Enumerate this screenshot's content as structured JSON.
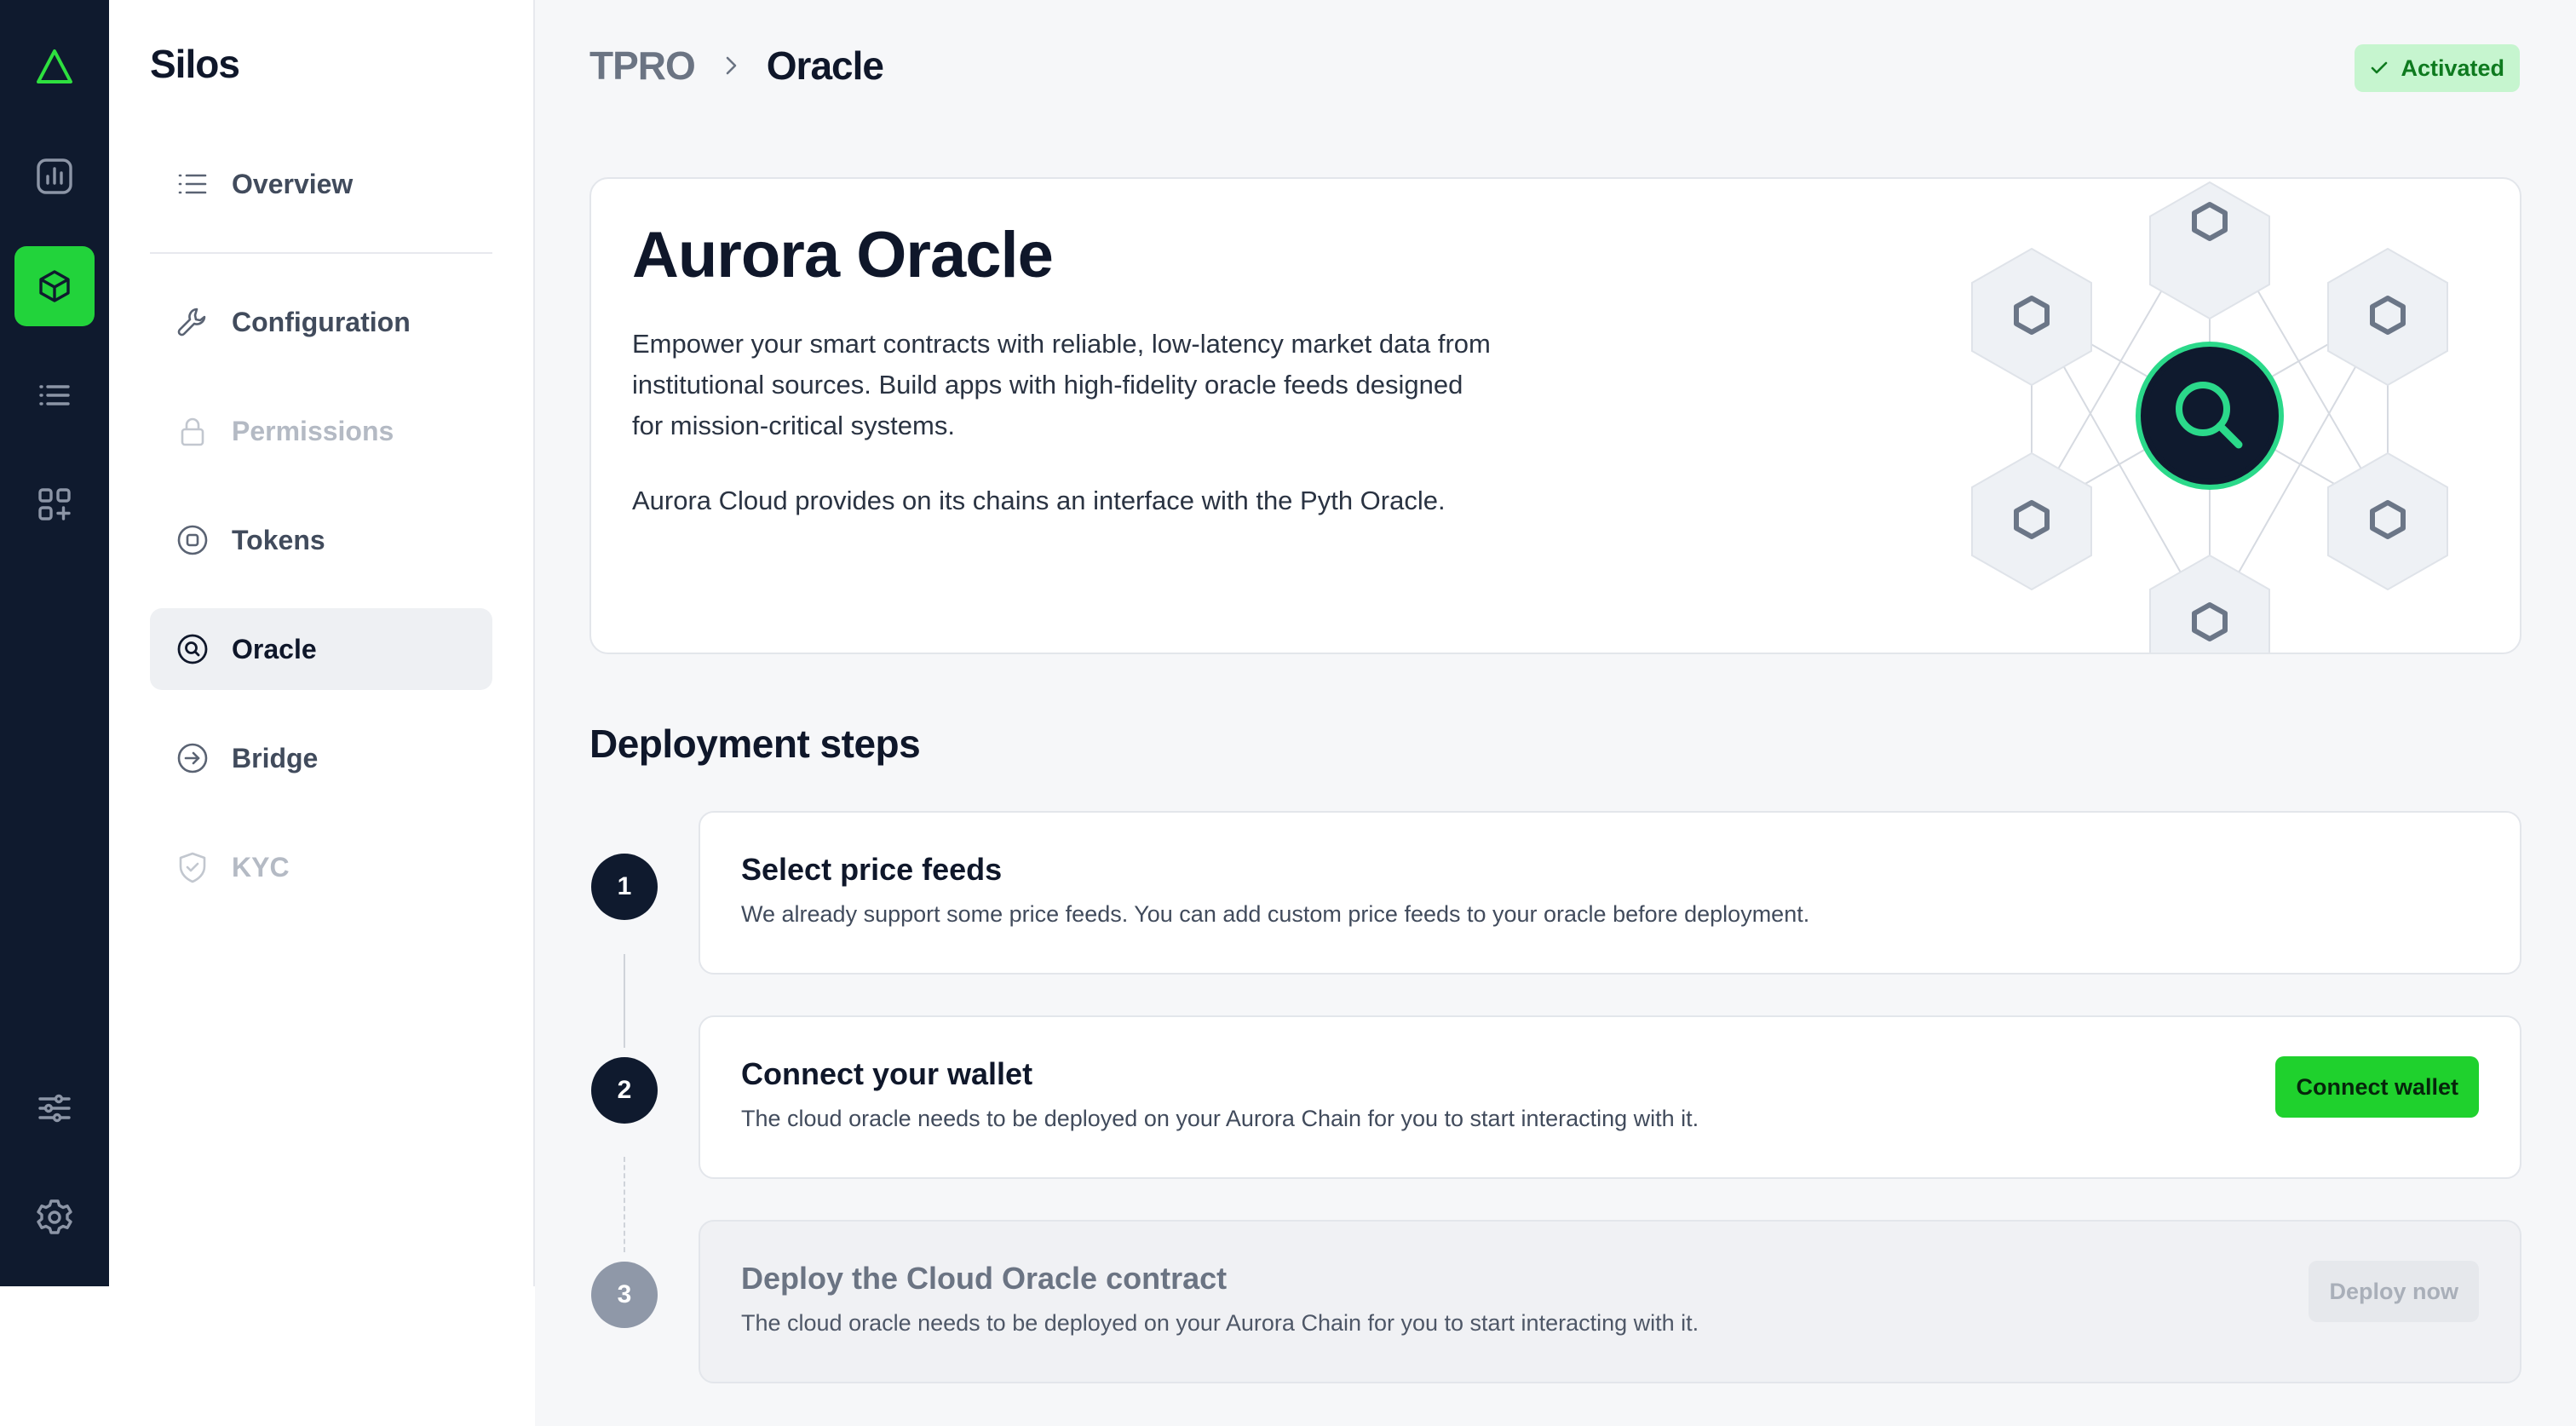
{
  "sidebar": {
    "title": "Silos",
    "items": [
      {
        "label": "Overview"
      },
      {
        "label": "Configuration"
      },
      {
        "label": "Permissions"
      },
      {
        "label": "Tokens"
      },
      {
        "label": "Oracle"
      },
      {
        "label": "Bridge"
      },
      {
        "label": "KYC"
      }
    ]
  },
  "header": {
    "breadcrumb_parent": "TPRO",
    "breadcrumb_current": "Oracle",
    "status_label": "Activated"
  },
  "hero": {
    "title": "Aurora Oracle",
    "paragraph1": "Empower your smart contracts with reliable, low-latency market data from institutional sources. Build apps with high-fidelity oracle feeds designed for mission-critical systems.",
    "paragraph2": "Aurora Cloud provides on its chains an interface with the Pyth Oracle."
  },
  "deployment": {
    "title": "Deployment steps",
    "steps": [
      {
        "number": "1",
        "title": "Select price feeds",
        "description": "We already support some price feeds. You can add custom price feeds to your oracle before deployment."
      },
      {
        "number": "2",
        "title": "Connect your wallet",
        "description": "The cloud oracle needs to be deployed on your Aurora Chain for you to start interacting with it.",
        "button": "Connect wallet"
      },
      {
        "number": "3",
        "title": "Deploy the Cloud Oracle contract",
        "description": "The cloud oracle needs to be deployed on your Aurora Chain for you to start interacting with it.",
        "button": "Deploy now"
      }
    ]
  },
  "colors": {
    "rail_bg": "#0f1a2e",
    "accent_green": "#22d33b",
    "badge_bg": "#c6f5cf",
    "badge_text": "#0e7a1f"
  },
  "icons": {
    "rail": [
      "aurora-logo-icon",
      "analytics-icon",
      "cube-icon",
      "list-icon",
      "apps-icon",
      "sliders-icon",
      "gear-icon"
    ],
    "nav": [
      "list-icon",
      "wrench-icon",
      "lock-icon",
      "token-icon",
      "search-icon",
      "arrow-circle-icon",
      "shield-check-icon"
    ]
  }
}
